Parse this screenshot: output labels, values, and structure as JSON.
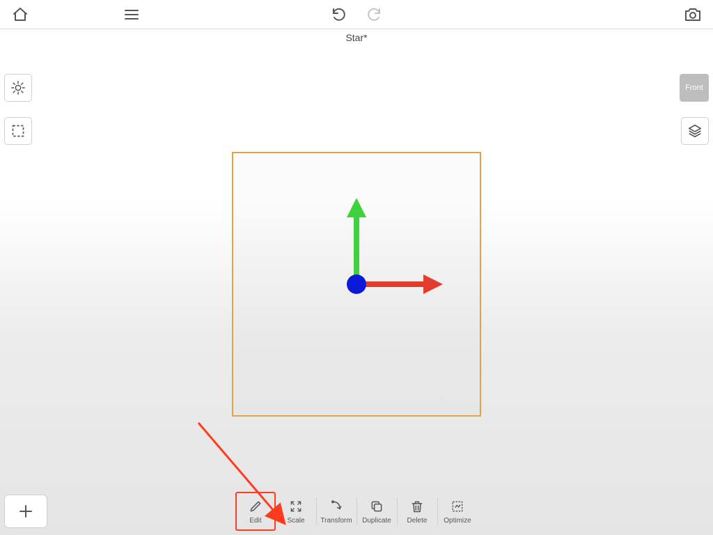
{
  "document": {
    "title": "Star*"
  },
  "view": {
    "label": "Front"
  },
  "gizmo": {
    "axis_x_color": "#e43b2f",
    "axis_y_color": "#3fd23f",
    "origin_color": "#0a19d6"
  },
  "context_toolbar": {
    "edit": {
      "label": "Edit"
    },
    "scale": {
      "label": "Scale"
    },
    "transform": {
      "label": "Transform"
    },
    "duplicate": {
      "label": "Duplicate"
    },
    "delete": {
      "label": "Delete"
    },
    "optimize": {
      "label": "Optimize"
    }
  },
  "annotation": {
    "target": "edit"
  }
}
